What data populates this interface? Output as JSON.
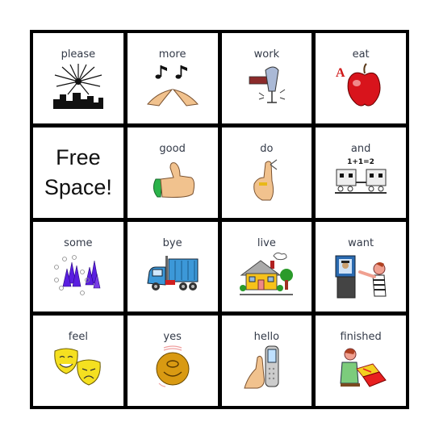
{
  "board": {
    "cells": [
      {
        "label": "please",
        "icon": "fireworks-icon"
      },
      {
        "label": "more",
        "icon": "hands-music-icon"
      },
      {
        "label": "work",
        "icon": "hammer-icon"
      },
      {
        "label": "eat",
        "icon": "apple-icon"
      },
      {
        "label": "Free Space!",
        "free": true
      },
      {
        "label": "good",
        "icon": "thumbs-up-icon"
      },
      {
        "label": "do",
        "icon": "finger-string-icon"
      },
      {
        "label": "and",
        "icon": "train-icon",
        "sublabel": "1+1=2"
      },
      {
        "label": "some",
        "icon": "cones-icon"
      },
      {
        "label": "bye",
        "icon": "truck-icon"
      },
      {
        "label": "live",
        "icon": "house-icon"
      },
      {
        "label": "want",
        "icon": "person-pointing-icon"
      },
      {
        "label": "feel",
        "icon": "masks-icon"
      },
      {
        "label": "yes",
        "icon": "nodding-head-icon"
      },
      {
        "label": "hello",
        "icon": "phone-icon"
      },
      {
        "label": "finished",
        "icon": "box-closing-icon"
      }
    ],
    "free_space": {
      "line1": "Free",
      "line2": "Space!"
    },
    "and_sublabel": "1+1=2",
    "colors": {
      "grid": "#000000",
      "label": "#333a48"
    }
  }
}
